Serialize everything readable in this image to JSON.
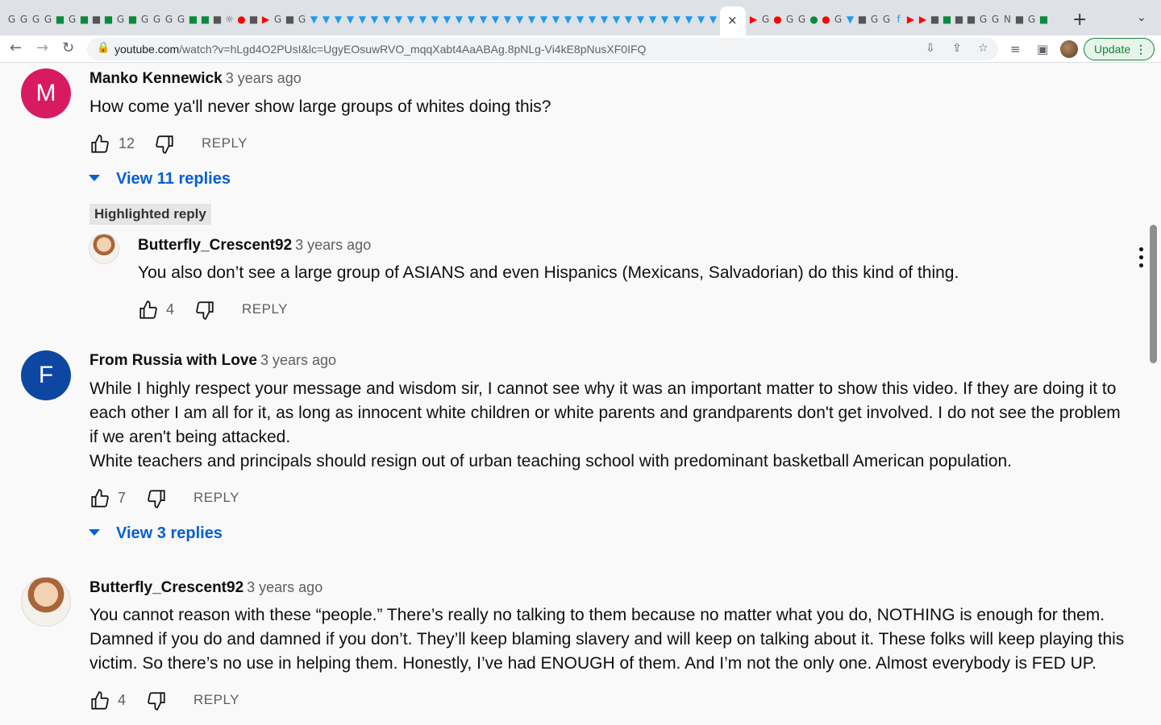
{
  "browser": {
    "url_host": "youtube.com",
    "url_path": "/watch?v=hLgd4O2PUsI&lc=UgyEOsuwRVO_mqqXabt4AaABAg.8pNLg-Vi4kE8pNusXF0IFQ",
    "update_label": "Update",
    "new_tab": "+",
    "tab_close": "×"
  },
  "comments": [
    {
      "avatar_letter": "M",
      "avatar_color": "#d81b60",
      "author": "Manko Kennewick",
      "time": "3 years ago",
      "text": [
        "How come ya'll never show large groups of whites doing this?"
      ],
      "likes": "12",
      "reply_label": "REPLY",
      "view_replies": "View 11 replies"
    },
    {
      "badge": "Highlighted reply",
      "author": "Butterfly_Crescent92",
      "time": "3 years ago",
      "text": [
        "You also don’t see a large group of ASIANS and even Hispanics (Mexicans, Salvadorian) do this kind of thing."
      ],
      "likes": "4",
      "reply_label": "REPLY"
    },
    {
      "avatar_letter": "F",
      "avatar_color": "#0d47a1",
      "author": "From Russia with Love",
      "time": "3 years ago",
      "text": [
        "While I highly respect your message and wisdom sir, I cannot see why it was an important matter to show this video. If they are doing it to",
        "each other I am all for it, as long as innocent white children or white parents and grandparents don't get involved. I do not see the problem",
        "if we aren't being attacked.",
        "White teachers and principals should resign out of urban teaching school with predominant basketball American population."
      ],
      "likes": "7",
      "reply_label": "REPLY",
      "view_replies": "View 3 replies"
    },
    {
      "author": "Butterfly_Crescent92",
      "time": "3 years ago",
      "text": [
        "You cannot reason with these “people.” There’s really no talking to them because no matter what you do, NOTHING is enough for them.",
        "Damned if you do and damned if you don’t. They’ll keep blaming slavery and will keep on talking about it. These folks will keep playing this",
        "victim. So there’s no use in helping them. Honestly, I’ve had ENOUGH of them. And I’m not the only one. Almost everybody is FED UP."
      ],
      "likes": "4",
      "reply_label": "REPLY"
    }
  ]
}
